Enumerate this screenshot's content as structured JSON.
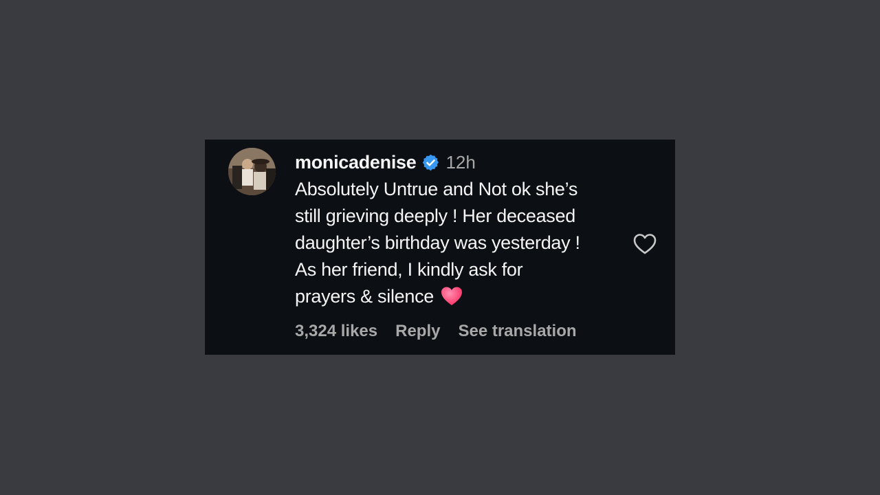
{
  "comment": {
    "username": "monicadenise",
    "verified": true,
    "timestamp": "12h",
    "text_lines": [
      "Absolutely Untrue and Not ok she’s",
      "still grieving deeply ! Her deceased",
      "daughter’s birthday was yesterday !",
      "As her friend, I kindly ask for",
      "prayers & silence"
    ],
    "emoji": "heart-emoji",
    "likes": "3,324 likes",
    "reply_label": "Reply",
    "translation_label": "See translation"
  },
  "colors": {
    "background": "#3a3b40",
    "card": "#0c0f14",
    "text_primary": "#f5f5f5",
    "text_secondary": "#a8a8a8",
    "verified_blue": "#3897f0",
    "heart_pink": "#ff3b6b"
  },
  "icons": {
    "avatar": "user-photo-avatar",
    "verified": "verified-badge-icon",
    "like": "heart-outline-icon"
  }
}
